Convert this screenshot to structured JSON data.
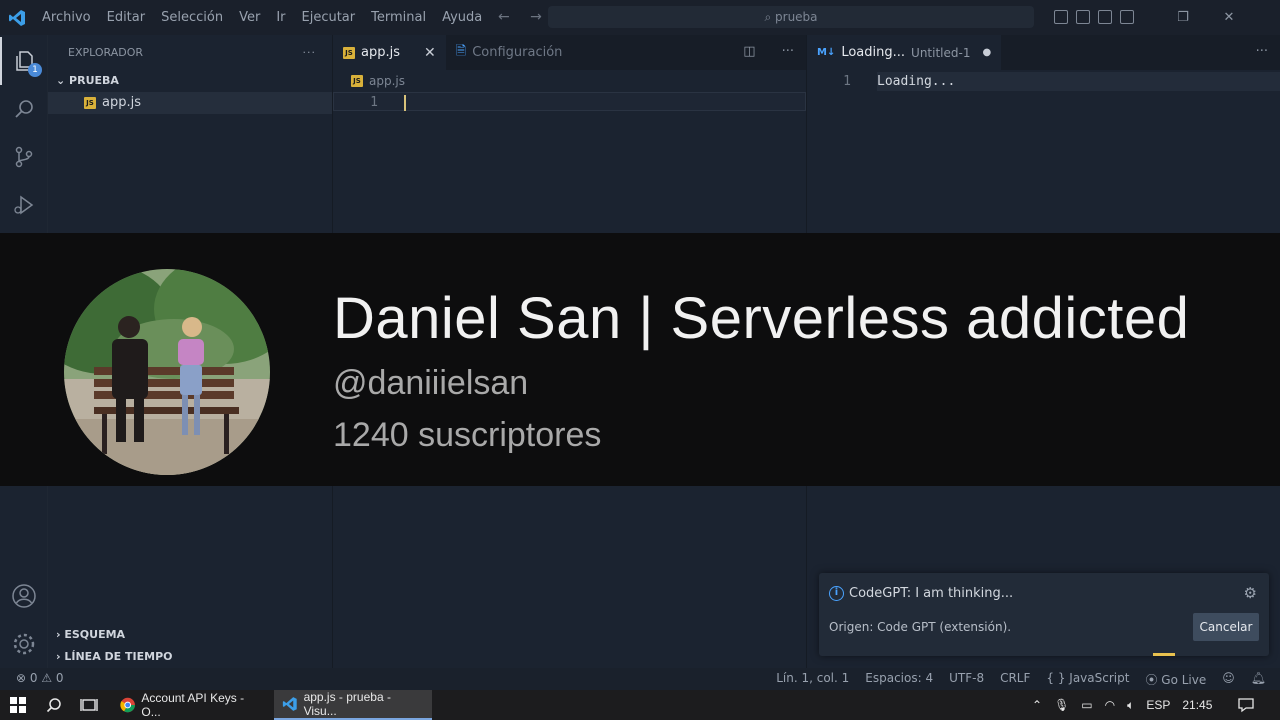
{
  "titlebar": {
    "menu": [
      "Archivo",
      "Editar",
      "Selección",
      "Ver",
      "Ir",
      "Ejecutar",
      "Terminal",
      "Ayuda"
    ],
    "search": "prueba",
    "nav_arrows": "← →"
  },
  "sidebar": {
    "header": "EXPLORADOR",
    "more": "···",
    "folder": "PRUEBA",
    "file": "app.js",
    "file_badge": "JS",
    "outline": "ESQUEMA",
    "timeline": "LÍNEA DE TIEMPO",
    "explorer_badge": "1"
  },
  "editor1": {
    "tabs": [
      {
        "label": "app.js",
        "close": "✕"
      },
      {
        "label": "Configuración"
      }
    ],
    "breadcrumb": "app.js",
    "line_number": "1",
    "more": "···"
  },
  "editor2": {
    "tab_label": "Loading...",
    "tab_desc": "Untitled-1",
    "tab_dot": "●",
    "line_number": "1",
    "line_text": "Loading...",
    "more": "···"
  },
  "banner": {
    "title": "Daniel San | Serverless addicted",
    "handle": "@daniiielsan",
    "subscribers": "1240 suscriptores"
  },
  "notification": {
    "message": "CodeGPT: I am thinking...",
    "source": "Origen: Code GPT (extensión).",
    "cancel": "Cancelar"
  },
  "statusbar": {
    "problems": "⊗ 0 ⚠ 0",
    "position": "Lín. 1, col. 1",
    "spaces": "Espacios: 4",
    "encoding": "UTF-8",
    "eol": "CRLF",
    "language": "{ } JavaScript",
    "golive": "Go Live"
  },
  "taskbar": {
    "apps": [
      {
        "label": "Account API Keys - O..."
      },
      {
        "label": "app.js - prueba - Visu..."
      }
    ],
    "lang": "ESP",
    "time": "21:45"
  },
  "colors": {
    "accent_blue": "#4aa3ff",
    "js_yellow": "#d9b13a",
    "progress_yellow": "#e8c14f"
  }
}
